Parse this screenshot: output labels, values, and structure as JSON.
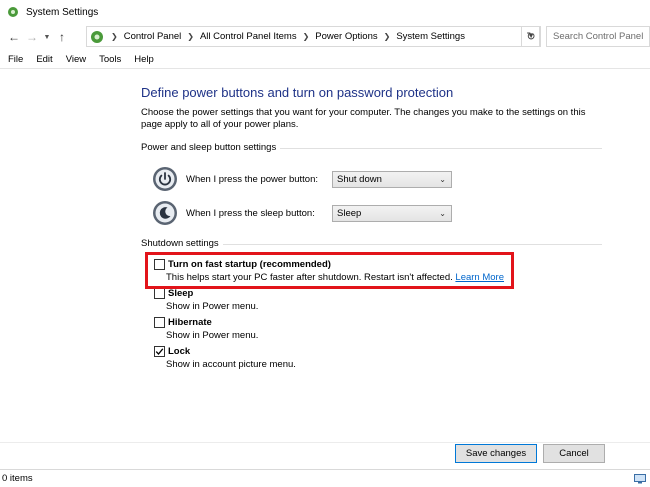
{
  "window": {
    "title": "System Settings"
  },
  "nav": {
    "breadcrumb": [
      "Control Panel",
      "All Control Panel Items",
      "Power Options",
      "System Settings"
    ],
    "search_placeholder": "Search Control Panel"
  },
  "menu": [
    "File",
    "Edit",
    "View",
    "Tools",
    "Help"
  ],
  "page": {
    "heading": "Define power buttons and turn on password protection",
    "description": "Choose the power settings that you want for your computer. The changes you make to the settings on this page apply to all of your power plans."
  },
  "power_section": {
    "label": "Power and sleep button settings",
    "power_button": {
      "label": "When I press the power button:",
      "value": "Shut down",
      "icon": "power-button-icon"
    },
    "sleep_button": {
      "label": "When I press the sleep button:",
      "value": "Sleep",
      "icon": "sleep-button-icon"
    }
  },
  "shutdown_section": {
    "label": "Shutdown settings",
    "options": [
      {
        "name": "Turn on fast startup (recommended)",
        "desc": "This helps start your PC faster after shutdown. Restart isn't affected.",
        "link": "Learn More",
        "checked": false
      },
      {
        "name": "Sleep",
        "desc": "Show in Power menu.",
        "checked": false
      },
      {
        "name": "Hibernate",
        "desc": "Show in Power menu.",
        "checked": false
      },
      {
        "name": "Lock",
        "desc": "Show in account picture menu.",
        "checked": true
      }
    ]
  },
  "buttons": {
    "save": "Save changes",
    "cancel": "Cancel"
  },
  "status": {
    "items": "0 items"
  },
  "colors": {
    "heading": "#1e3287",
    "highlight": "#e2141a",
    "link": "#0066cc"
  }
}
